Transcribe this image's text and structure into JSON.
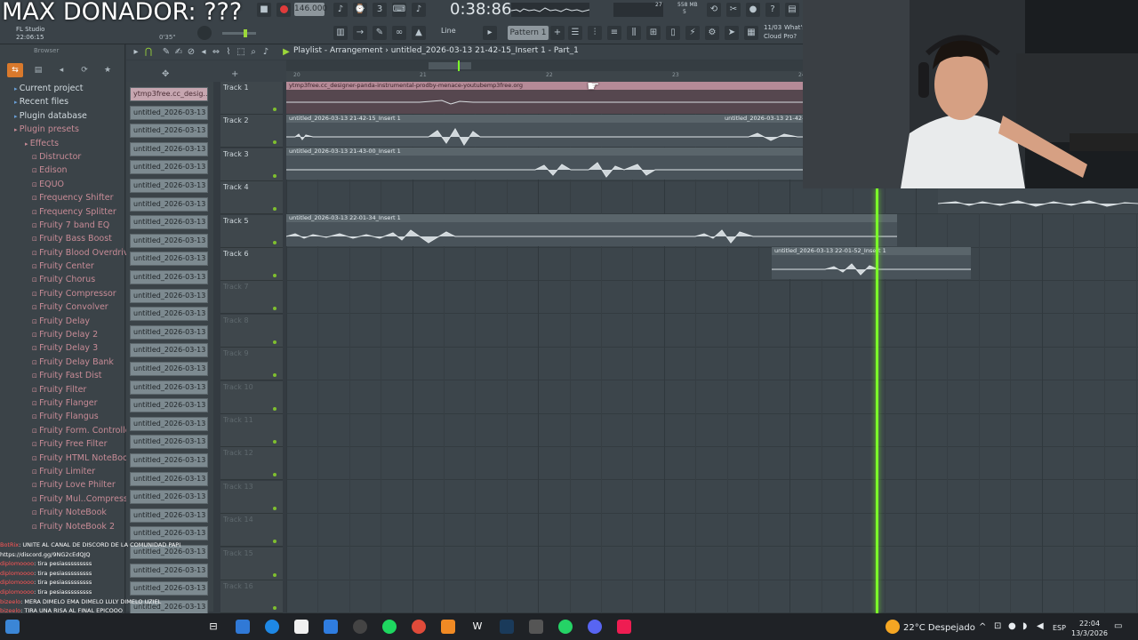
{
  "stream": {
    "title": "MAX DONADOR: ???"
  },
  "toolbar": {
    "app_name": "FL Studio",
    "app_time": "22:06:15",
    "position_small": "0'35\"",
    "tempo": "146.000",
    "song_time": "0:38:86",
    "memory": "558 MB",
    "cpu_count": "5",
    "mem_small": "27",
    "snap_mode": "Line",
    "pattern": "Pattern 1",
    "news_date": "11/03",
    "news_text": "What's",
    "cloud_text": "Cloud Pro?",
    "accent_color": "#7cff29",
    "record_color": "#e03b3b"
  },
  "browser": {
    "header": "Browser",
    "items": [
      {
        "label": "Current project",
        "kind": "folder"
      },
      {
        "label": "Recent files",
        "kind": "folder"
      },
      {
        "label": "Plugin database",
        "kind": "folder"
      },
      {
        "label": "Plugin presets",
        "kind": "plug"
      },
      {
        "label": "Effects",
        "kind": "plug"
      },
      {
        "label": "Distructor",
        "kind": "effect"
      },
      {
        "label": "Edison",
        "kind": "effect"
      },
      {
        "label": "EQUO",
        "kind": "effect"
      },
      {
        "label": "Frequency Shifter",
        "kind": "effect"
      },
      {
        "label": "Frequency Splitter",
        "kind": "effect"
      },
      {
        "label": "Fruity 7 band EQ",
        "kind": "effect"
      },
      {
        "label": "Fruity Bass Boost",
        "kind": "effect"
      },
      {
        "label": "Fruity Blood Overdrive",
        "kind": "effect"
      },
      {
        "label": "Fruity Center",
        "kind": "effect"
      },
      {
        "label": "Fruity Chorus",
        "kind": "effect"
      },
      {
        "label": "Fruity Compressor",
        "kind": "effect"
      },
      {
        "label": "Fruity Convolver",
        "kind": "effect"
      },
      {
        "label": "Fruity Delay",
        "kind": "effect"
      },
      {
        "label": "Fruity Delay 2",
        "kind": "effect"
      },
      {
        "label": "Fruity Delay 3",
        "kind": "effect"
      },
      {
        "label": "Fruity Delay Bank",
        "kind": "effect"
      },
      {
        "label": "Fruity Fast Dist",
        "kind": "effect"
      },
      {
        "label": "Fruity Filter",
        "kind": "effect"
      },
      {
        "label": "Fruity Flanger",
        "kind": "effect"
      },
      {
        "label": "Fruity Flangus",
        "kind": "effect"
      },
      {
        "label": "Fruity Form. Controller",
        "kind": "effect"
      },
      {
        "label": "Fruity Free Filter",
        "kind": "effect"
      },
      {
        "label": "Fruity HTML NoteBook",
        "kind": "effect"
      },
      {
        "label": "Fruity Limiter",
        "kind": "effect"
      },
      {
        "label": "Fruity Love Philter",
        "kind": "effect"
      },
      {
        "label": "Fruity Mul..Compressor",
        "kind": "effect"
      },
      {
        "label": "Fruity NoteBook",
        "kind": "effect"
      },
      {
        "label": "Fruity NoteBook 2",
        "kind": "effect"
      }
    ]
  },
  "clip_sources": [
    "ytmp3free.cc_desig...",
    "untitled_2026-03-13 21-",
    "untitled_2026-03-13 21-",
    "untitled_2026-03-13 21-",
    "untitled_2026-03-13 21-",
    "untitled_2026-03-13 21-",
    "untitled_2026-03-13 21-",
    "untitled_2026-03-13 21-",
    "untitled_2026-03-13 21-",
    "untitled_2026-03-13 21-",
    "untitled_2026-03-13 21-",
    "untitled_2026-03-13 21-",
    "untitled_2026-03-13 21-",
    "untitled_2026-03-13 21-",
    "untitled_2026-03-13 21-",
    "untitled_2026-03-13 21-",
    "untitled_2026-03-13 21-",
    "untitled_2026-03-13 21-",
    "untitled_2026-03-13 21-",
    "untitled_2026-03-13 21-",
    "untitled_2026-03-13 21-",
    "untitled_2026-03-13 21-",
    "untitled_2026-03-13 21-",
    "untitled_2026-03-13 21-",
    "untitled_2026-03-13 21-",
    "untitled_2026-03-13 21-",
    "untitled_2026-03-13 21-",
    "untitled_2026-03-13 21-",
    "untitled_2026-03-13 21-"
  ],
  "playlist": {
    "title": "Playlist - Arrangement",
    "breadcrumb": "untitled_2026-03-13 21-42-15_Insert 1 - Part_1",
    "ruler": [
      "20",
      "21",
      "22",
      "23",
      "24"
    ],
    "tracks": [
      "Track 1",
      "Track 2",
      "Track 3",
      "Track 4",
      "Track 5",
      "Track 6",
      "Track 7",
      "Track 8",
      "Track 9",
      "Track 10",
      "Track 11",
      "Track 12",
      "Track 13",
      "Track 14",
      "Track 15",
      "Track 16"
    ],
    "clips": {
      "t1": "ytmp3free.cc_designer-panda-instrumental-prodby-menace-youtubemp3free.org",
      "t2a": "untitled_2026-03-13 21-42-15_Insert 1",
      "t2b": "untitled_2026-03-13 21-42-",
      "t3": "untitled_2026-03-13 21-43-00_Insert 1",
      "t5": "untitled_2026-03-13 22-01-34_Insert 1",
      "t6": "untitled_2026-03-13 22-01-52_Insert 1"
    }
  },
  "chat": [
    {
      "user": "BotRix",
      "text": ": UNITE AL CANAL DE DISCORD DE LA COMUNIDAD PAPI"
    },
    {
      "user": "",
      "text": "https://discord.gg/9NG2cEdQJQ"
    },
    {
      "user": "diplomoooo",
      "text": ": tira pesiasssssssss"
    },
    {
      "user": "diplomoooo",
      "text": ": tira pesiasssssssss"
    },
    {
      "user": "diplomoooo",
      "text": ": tira pesiasssssssss"
    },
    {
      "user": "diplomoooo",
      "text": ": tira pesiasssssssss"
    },
    {
      "user": "bizeelo",
      "text": ": MERA DIMELO EMA DIMELO LULY DIMELO UZIEL"
    },
    {
      "user": "bizeelo",
      "text": ": TIRA UNA RISA AL FINAL EPICOOO"
    },
    {
      "user": "bizeelo",
      "text": ": TIRA UNA RISA AL FINAL EPICOOO"
    }
  ],
  "taskbar": {
    "weather": "22°C Despejado",
    "lang": "ESP",
    "time": "22:04",
    "date": "13/3/2026"
  }
}
